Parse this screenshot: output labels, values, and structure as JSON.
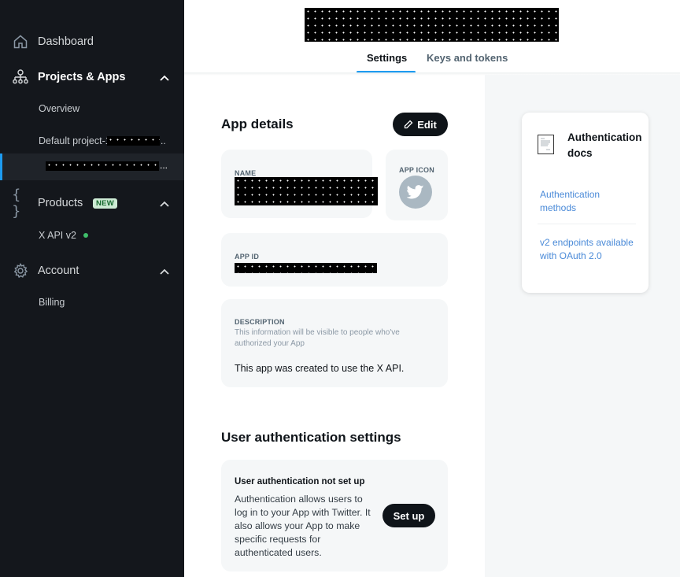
{
  "sidebar": {
    "dashboard": {
      "label": "Dashboard",
      "icon": "home-icon"
    },
    "projects": {
      "label": "Projects & Apps",
      "icon": "org-chart-icon",
      "expanded": true,
      "items": [
        {
          "label": "Overview"
        },
        {
          "label": "Default project-1",
          "redacted_suffix": true,
          "suffix": ".."
        },
        {
          "label": "",
          "redacted": true,
          "active": true,
          "suffix": "..."
        }
      ]
    },
    "products": {
      "label": "Products",
      "badge": "NEW",
      "icon": "braces-icon",
      "expanded": true,
      "items": [
        {
          "label": "X API v2",
          "status": "active"
        }
      ]
    },
    "account": {
      "label": "Account",
      "icon": "gear-icon",
      "expanded": true,
      "items": [
        {
          "label": "Billing"
        }
      ]
    }
  },
  "header": {
    "title_redacted": true,
    "tabs": [
      {
        "label": "Settings",
        "active": true
      },
      {
        "label": "Keys and tokens",
        "active": false
      }
    ]
  },
  "app_details": {
    "heading": "App details",
    "edit_label": "Edit",
    "name": {
      "label": "NAME",
      "value_redacted": true
    },
    "app_icon": {
      "label": "APP ICON",
      "icon": "twitter-bird-icon"
    },
    "app_id": {
      "label": "APP ID",
      "value_redacted": true
    },
    "description": {
      "label": "DESCRIPTION",
      "hint": "This information will be visible to people who've authorized your App",
      "value": "This app was created to use the X API."
    }
  },
  "user_auth": {
    "heading": "User authentication settings",
    "status_title": "User authentication not set up",
    "body": "Authentication allows users to log in to your App with Twitter. It also allows your App to make specific requests for authenticated users.",
    "setup_label": "Set up"
  },
  "docs": {
    "title": "Authentication docs",
    "links": [
      {
        "label": "Authentication methods"
      },
      {
        "label": "v2 endpoints available with OAuth 2.0"
      }
    ]
  },
  "colors": {
    "sidebar_bg": "#14171c",
    "accent": "#1d9bf0",
    "link": "#4a8ad8",
    "button_dark": "#0f1419",
    "badge_bg": "#cdebd4",
    "status_green": "#3fbf6a"
  }
}
